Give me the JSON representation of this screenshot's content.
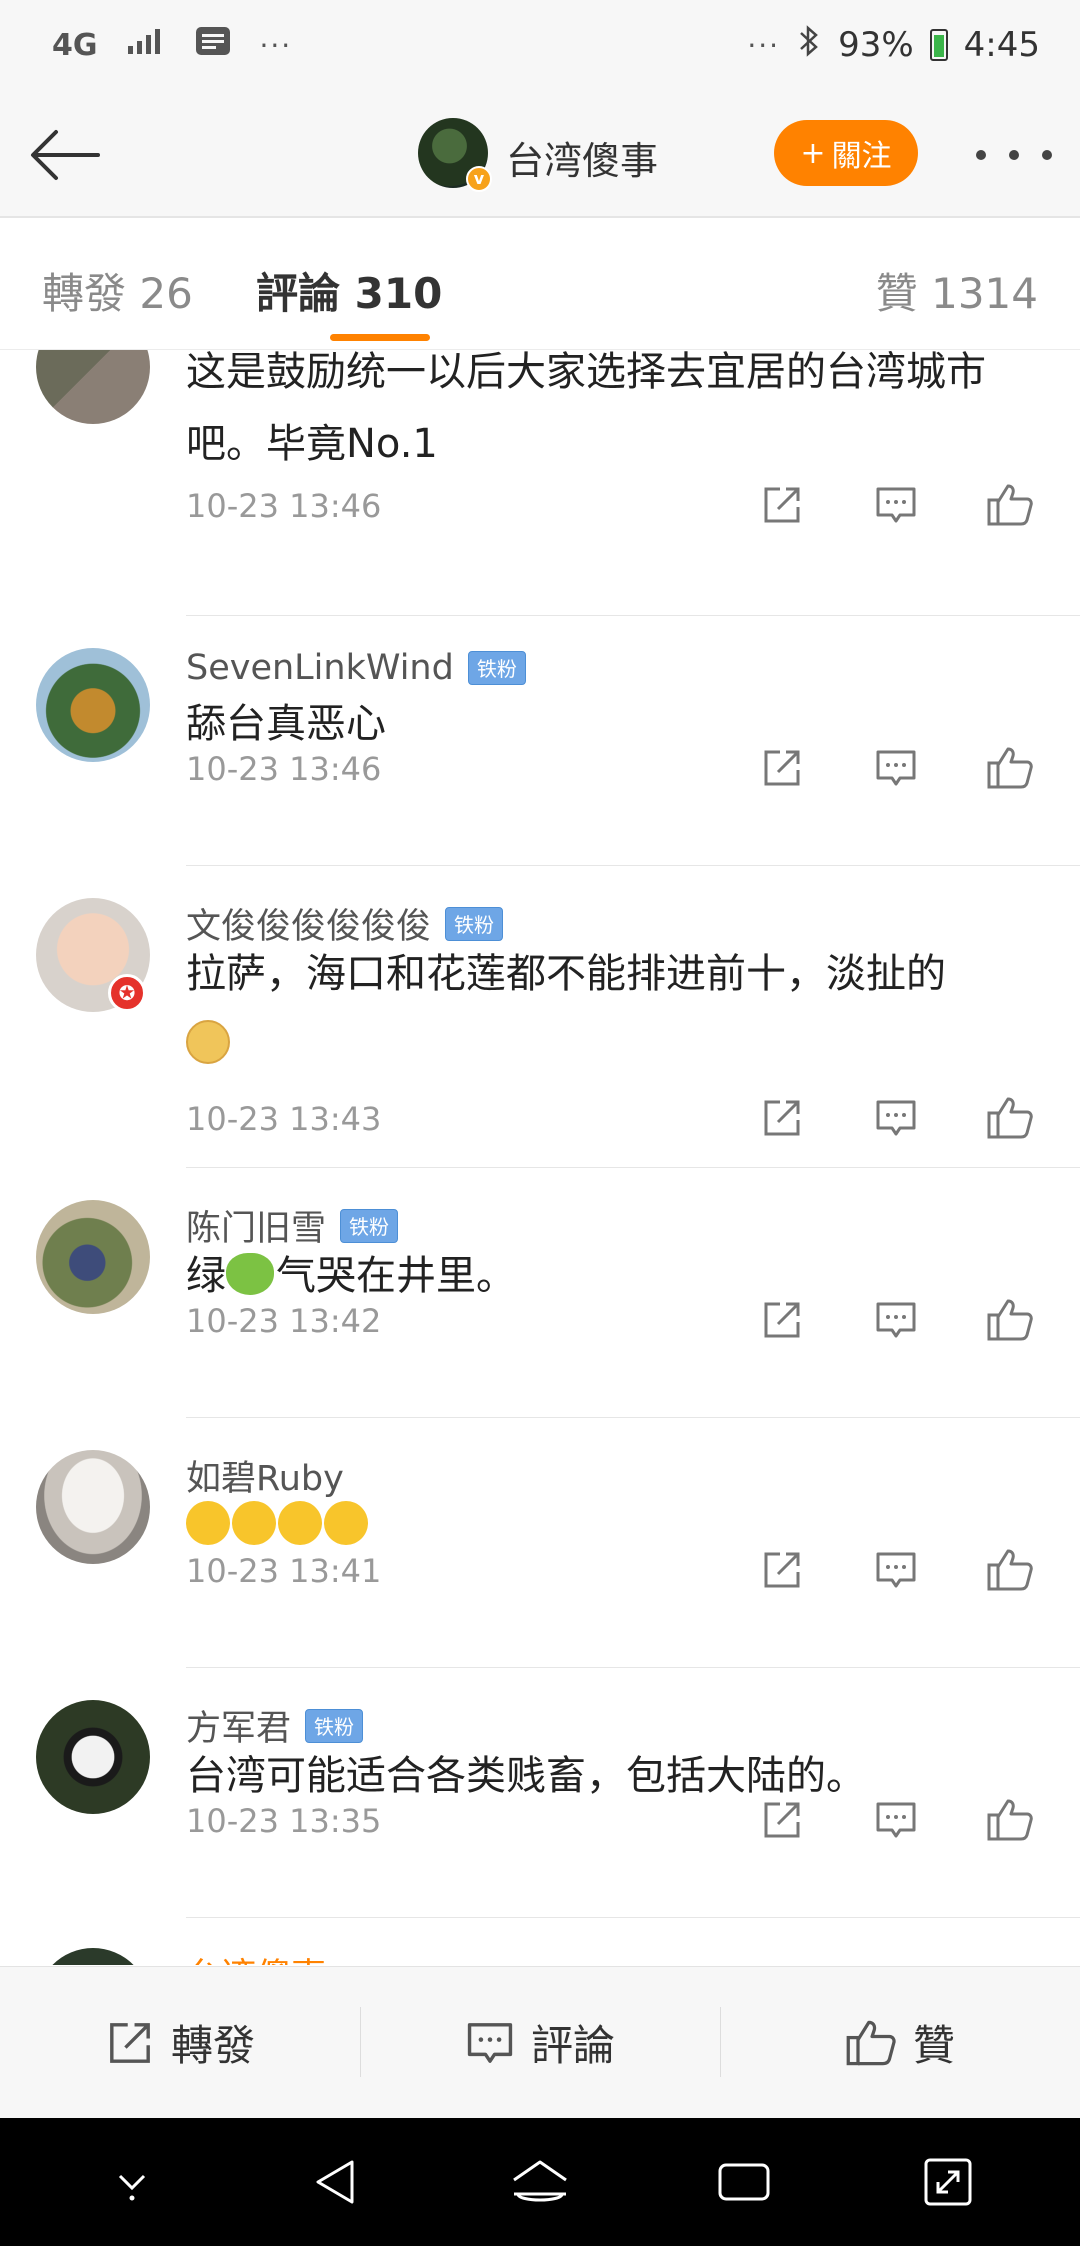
{
  "status_bar": {
    "network": "4G",
    "dots": "···",
    "right_dots": "···",
    "battery": "93%",
    "time": "4:45"
  },
  "header": {
    "page_name": "台湾傻事",
    "follow_label": "關注",
    "follow_plus": "+"
  },
  "tabs": {
    "repost": "轉發 26",
    "comment": "評論 310",
    "like": "贊 1314"
  },
  "comments": [
    {
      "username": "",
      "text": "这是鼓励统一以后大家选择去宜居的台湾城市吧。毕竟No.1",
      "time": "10-23 13:46"
    },
    {
      "username": "SevenLinkWind",
      "badge": "铁粉",
      "text": "舔台真恶心",
      "time": "10-23 13:46"
    },
    {
      "username": "文俊俊俊俊俊俊",
      "badge": "铁粉",
      "text": "拉萨，海口和花莲都不能排进前十，淡扯的",
      "time": "10-23 13:43"
    },
    {
      "username": "陈门旧雪",
      "badge": "铁粉",
      "text_before": "绿",
      "text_after": "气哭在井里。",
      "time": "10-23 13:42"
    },
    {
      "username": "如碧Ruby",
      "text": "",
      "time": "10-23 13:41"
    },
    {
      "username": "方军君",
      "badge": "铁粉",
      "text": "台湾可能适合各类贱畜，包括大陆的。",
      "time": "10-23 13:35"
    }
  ],
  "partial_comment": {
    "username": "台湾傻事"
  },
  "bottom_bar": {
    "repost": "轉發",
    "comment": "評論",
    "like": "贊"
  },
  "colors": {
    "accent": "#ff8200",
    "badge": "#6ea6e6",
    "muted": "#999999"
  }
}
